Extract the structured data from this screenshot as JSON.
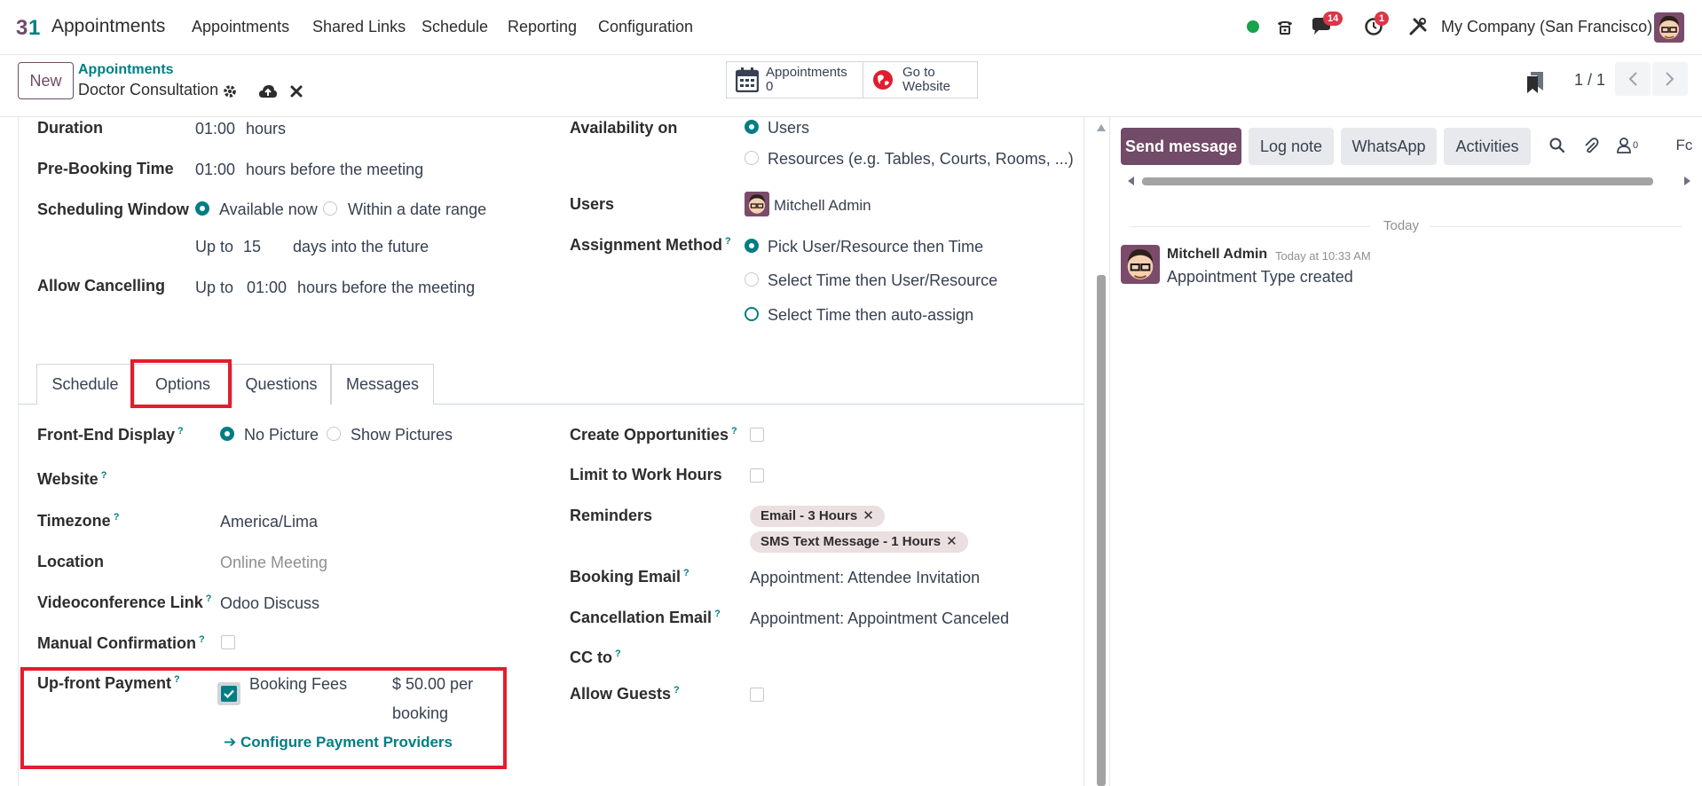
{
  "navbar": {
    "app_title": "Appointments",
    "menu": [
      "Appointments",
      "Shared Links",
      "Schedule",
      "Reporting",
      "Configuration"
    ],
    "messages_badge": "14",
    "activities_badge": "1",
    "company": "My Company (San Francisco)"
  },
  "control": {
    "new_label": "New",
    "breadcrumb_parent": "Appointments",
    "breadcrumb_current": "Doctor Consultation",
    "stat_appointments_label": "Appointments",
    "stat_appointments_value": "0",
    "goto_line1": "Go to",
    "goto_line2": "Website",
    "pager": "1 / 1"
  },
  "form_top": {
    "duration_label": "Duration",
    "duration_value": "01:00",
    "duration_unit": "hours",
    "prebooking_label": "Pre-Booking Time",
    "prebooking_value": "01:00",
    "prebooking_unit": "hours before the meeting",
    "window_label": "Scheduling Window",
    "window_opt1": "Available now",
    "window_opt2": "Within a date range",
    "upto_label": "Up to",
    "upto_value": "15",
    "upto_unit": "days into the future",
    "cancel_label": "Allow Cancelling",
    "cancel_upto": "Up to",
    "cancel_value": "01:00",
    "cancel_unit": "hours before the meeting",
    "availability_label": "Availability on",
    "availability_opt1": "Users",
    "availability_opt2": "Resources (e.g. Tables, Courts, Rooms, ...)",
    "users_label": "Users",
    "users_value": "Mitchell Admin",
    "assignment_label": "Assignment Method",
    "assignment_opt1": "Pick User/Resource then Time",
    "assignment_opt2": "Select Time then User/Resource",
    "assignment_opt3": "Select Time then auto-assign"
  },
  "tabs": [
    "Schedule",
    "Options",
    "Questions",
    "Messages"
  ],
  "options": {
    "frontend_label": "Front-End Display",
    "frontend_opt1": "No Picture",
    "frontend_opt2": "Show Pictures",
    "website_label": "Website",
    "timezone_label": "Timezone",
    "timezone_value": "America/Lima",
    "location_label": "Location",
    "location_placeholder": "Online Meeting",
    "video_label": "Videoconference Link",
    "video_value": "Odoo Discuss",
    "manual_label": "Manual Confirmation",
    "upfront_label": "Up-front Payment",
    "booking_fees_label": "Booking Fees",
    "fee_amount": "$ 50.00 per",
    "fee_unit": "booking",
    "configure_link": "Configure Payment Providers",
    "create_opp_label": "Create Opportunities",
    "limit_hours_label": "Limit to Work Hours",
    "reminders_label": "Reminders",
    "reminder_tags": [
      "Email - 3 Hours",
      "SMS Text Message - 1 Hours"
    ],
    "booking_email_label": "Booking Email",
    "booking_email_value": "Appointment: Attendee Invitation",
    "cancellation_email_label": "Cancellation Email",
    "cancellation_email_value": "Appointment: Appointment Canceled",
    "cc_label": "CC to",
    "guests_label": "Allow Guests"
  },
  "chatter": {
    "send_message": "Send message",
    "log_note": "Log note",
    "whatsapp": "WhatsApp",
    "activities": "Activities",
    "followers_count": "0",
    "follow_truncated": "Fc",
    "today": "Today",
    "author": "Mitchell Admin",
    "time": "Today at 10:33 AM",
    "body": "Appointment Type created"
  },
  "colors": {
    "primary": "#714b67",
    "accent": "#017e84",
    "highlight_box": "#e11d2e",
    "badge": "#dc3545"
  }
}
